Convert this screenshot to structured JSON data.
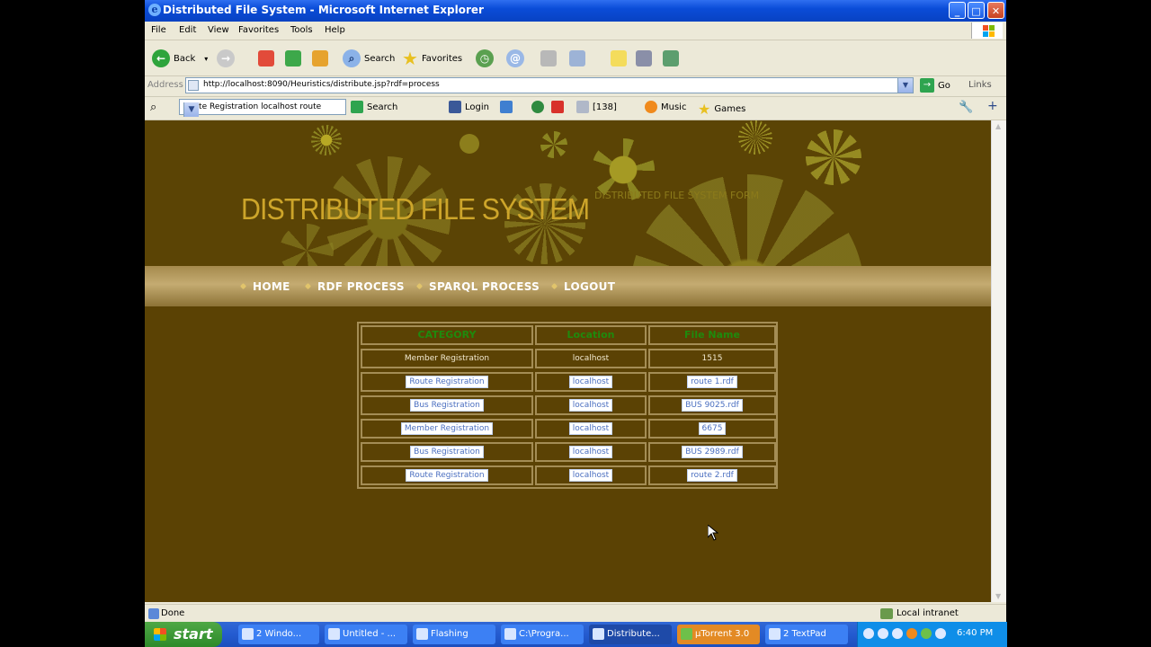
{
  "window": {
    "title": "Distributed File System - Microsoft Internet Explorer",
    "minimize": "_",
    "maximize": "□",
    "close": "✕"
  },
  "menu": [
    "File",
    "Edit",
    "View",
    "Favorites",
    "Tools",
    "Help"
  ],
  "toolbar": {
    "back": "Back",
    "search": "Search",
    "favorites": "Favorites"
  },
  "address": {
    "label": "Address",
    "url": "http://localhost:8090/Heuristics/distribute.jsp?rdf=process",
    "go": "Go",
    "links": "Links"
  },
  "searchbar": {
    "query": "Route Registration localhost route",
    "search": "Search",
    "login": "Login",
    "count": "[138]",
    "music": "Music",
    "games": "Games"
  },
  "page": {
    "title": "DISTRIBUTED FILE SYSTEM",
    "subtitle": "DISTRIBUTED FILE SYSTEM FORM",
    "nav": [
      "HOME",
      "RDF PROCESS",
      "SPARQL PROCESS",
      "LOGOUT"
    ]
  },
  "table": {
    "headers": [
      "CATEGORY",
      "Location",
      "File Name"
    ],
    "rows": [
      {
        "category": "Member Registration",
        "location": "localhost",
        "file": "1515",
        "link": false
      },
      {
        "category": "Route Registration",
        "location": "localhost",
        "file": "route 1.rdf",
        "link": true
      },
      {
        "category": "Bus Registration",
        "location": "localhost",
        "file": "BUS 9025.rdf",
        "link": true
      },
      {
        "category": "Member Registration",
        "location": "localhost",
        "file": "6675",
        "link": true
      },
      {
        "category": "Bus Registration",
        "location": "localhost",
        "file": "BUS 2989.rdf",
        "link": true
      },
      {
        "category": "Route Registration",
        "location": "localhost",
        "file": "route 2.rdf",
        "link": true
      }
    ]
  },
  "status": {
    "left": "Done",
    "right": "Local intranet"
  },
  "taskbar": {
    "start": "start",
    "tasks": [
      "2 Windo...",
      "Untitled - ...",
      "Flashing",
      "C:\\Progra...",
      "Distribute...",
      "µTorrent 3.0",
      "2 TextPad"
    ],
    "clock": "6:40 PM"
  }
}
